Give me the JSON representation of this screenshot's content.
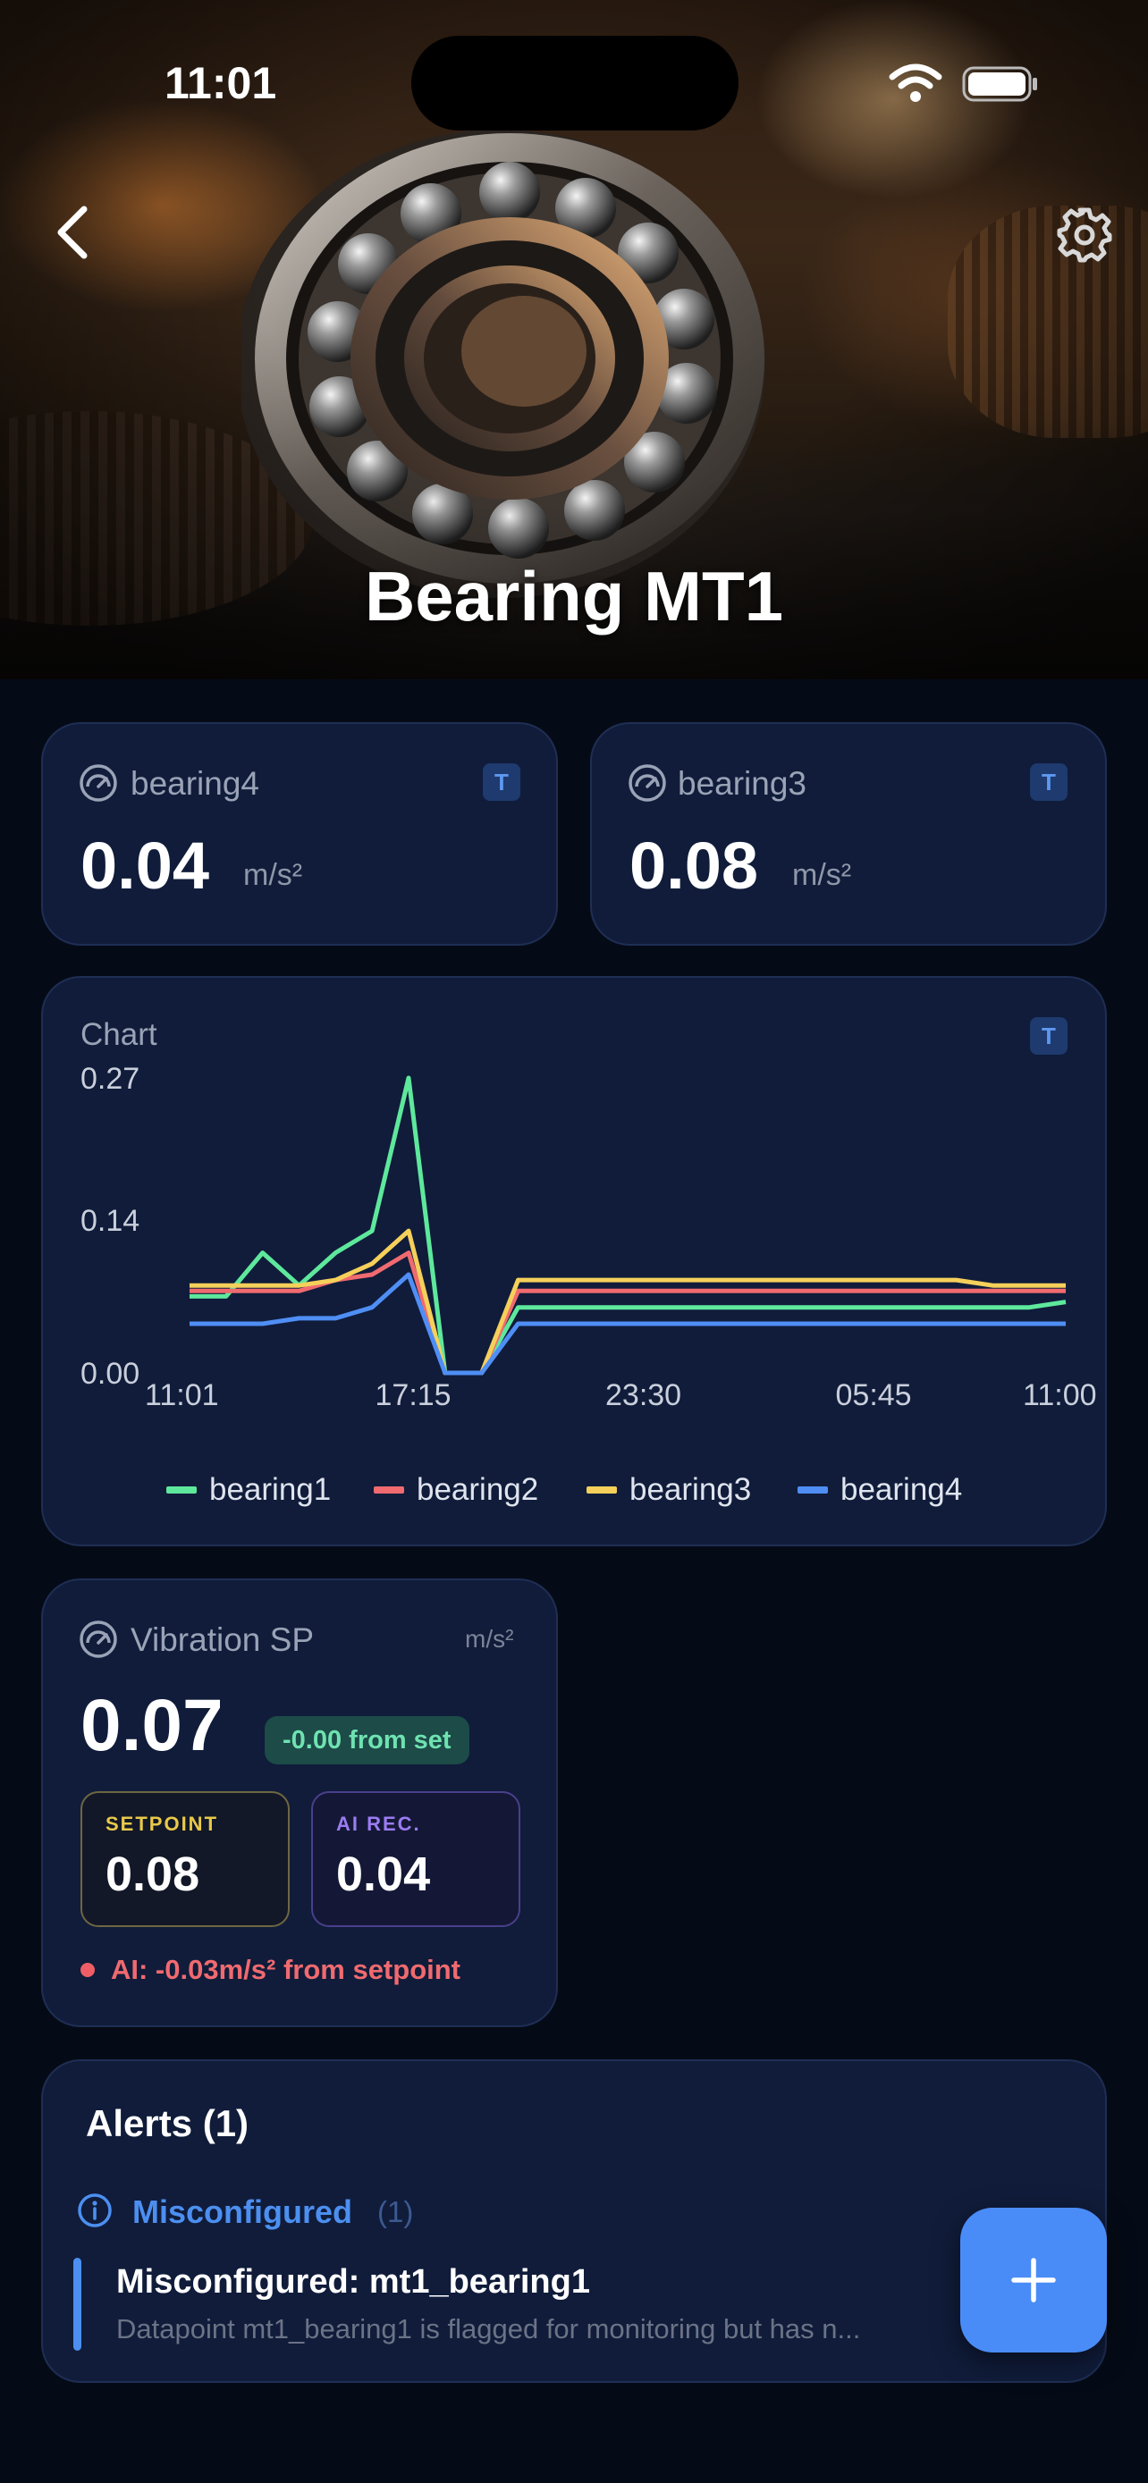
{
  "status_bar": {
    "time": "11:01",
    "icons": [
      "wifi-icon",
      "battery-icon"
    ]
  },
  "header": {
    "title": "Bearing MT1",
    "back_icon": "chevron-left-icon",
    "settings_icon": "gear-icon"
  },
  "sensor_cards": [
    {
      "label": "bearing4",
      "value": "0.04",
      "unit": "m/s²",
      "badge": "T",
      "icon": "gauge-icon"
    },
    {
      "label": "bearing3",
      "value": "0.08",
      "unit": "m/s²",
      "badge": "T",
      "icon": "gauge-icon"
    }
  ],
  "chart_card": {
    "title": "Chart",
    "badge": "T"
  },
  "chart_data": {
    "type": "line",
    "x": [
      "11:01",
      "12:00",
      "13:00",
      "14:00",
      "15:00",
      "16:00",
      "17:00",
      "18:00",
      "19:00",
      "20:00",
      "21:00",
      "22:00",
      "23:00",
      "00:00",
      "01:00",
      "02:00",
      "03:00",
      "04:00",
      "05:00",
      "06:00",
      "07:00",
      "08:00",
      "09:00",
      "10:00",
      "11:00"
    ],
    "x_ticks": [
      "11:01",
      "17:15",
      "23:30",
      "05:45",
      "11:00"
    ],
    "y_ticks": [
      "0.27",
      "0.14",
      "0.00"
    ],
    "ylim": [
      0,
      0.27
    ],
    "grid": false,
    "legend": "bottom",
    "series": [
      {
        "name": "bearing1",
        "color": "#5ee89c",
        "values": [
          0.07,
          0.07,
          0.11,
          0.08,
          0.11,
          0.13,
          0.27,
          0.0,
          0.0,
          0.06,
          0.06,
          0.06,
          0.06,
          0.06,
          0.06,
          0.06,
          0.06,
          0.06,
          0.06,
          0.06,
          0.06,
          0.06,
          0.06,
          0.06,
          0.065
        ]
      },
      {
        "name": "bearing2",
        "color": "#f06a6f",
        "values": [
          0.075,
          0.075,
          0.075,
          0.075,
          0.085,
          0.09,
          0.11,
          0.0,
          0.0,
          0.075,
          0.075,
          0.075,
          0.075,
          0.075,
          0.075,
          0.075,
          0.075,
          0.075,
          0.075,
          0.075,
          0.075,
          0.075,
          0.075,
          0.075,
          0.075
        ]
      },
      {
        "name": "bearing3",
        "color": "#f5d05a",
        "values": [
          0.08,
          0.08,
          0.08,
          0.08,
          0.085,
          0.1,
          0.13,
          0.0,
          0.0,
          0.085,
          0.085,
          0.085,
          0.085,
          0.085,
          0.085,
          0.085,
          0.085,
          0.085,
          0.085,
          0.085,
          0.085,
          0.085,
          0.08,
          0.08,
          0.08
        ]
      },
      {
        "name": "bearing4",
        "color": "#4f8ef5",
        "values": [
          0.045,
          0.045,
          0.045,
          0.05,
          0.05,
          0.06,
          0.09,
          0.0,
          0.0,
          0.045,
          0.045,
          0.045,
          0.045,
          0.045,
          0.045,
          0.045,
          0.045,
          0.045,
          0.045,
          0.045,
          0.045,
          0.045,
          0.045,
          0.045,
          0.045
        ]
      }
    ]
  },
  "vibration_card": {
    "label": "Vibration SP",
    "unit": "m/s²",
    "value": "0.07",
    "delta_text": "-0.00 from set",
    "setpoint_label": "SETPOINT",
    "setpoint_value": "0.08",
    "ai_label": "AI REC.",
    "ai_value": "0.04",
    "ai_note": "AI: -0.03m/s² from setpoint",
    "colors": {
      "setpoint": "#e8c94a",
      "ai": "#9b7cf2"
    }
  },
  "alerts": {
    "title": "Alerts (1)",
    "group_label": "Misconfigured",
    "group_count": "(1)",
    "items": [
      {
        "title": "Misconfigured: mt1_bearing1",
        "description": "Datapoint mt1_bearing1 is flagged for monitoring but has n..."
      }
    ]
  },
  "fab": {
    "icon": "plus-icon"
  }
}
